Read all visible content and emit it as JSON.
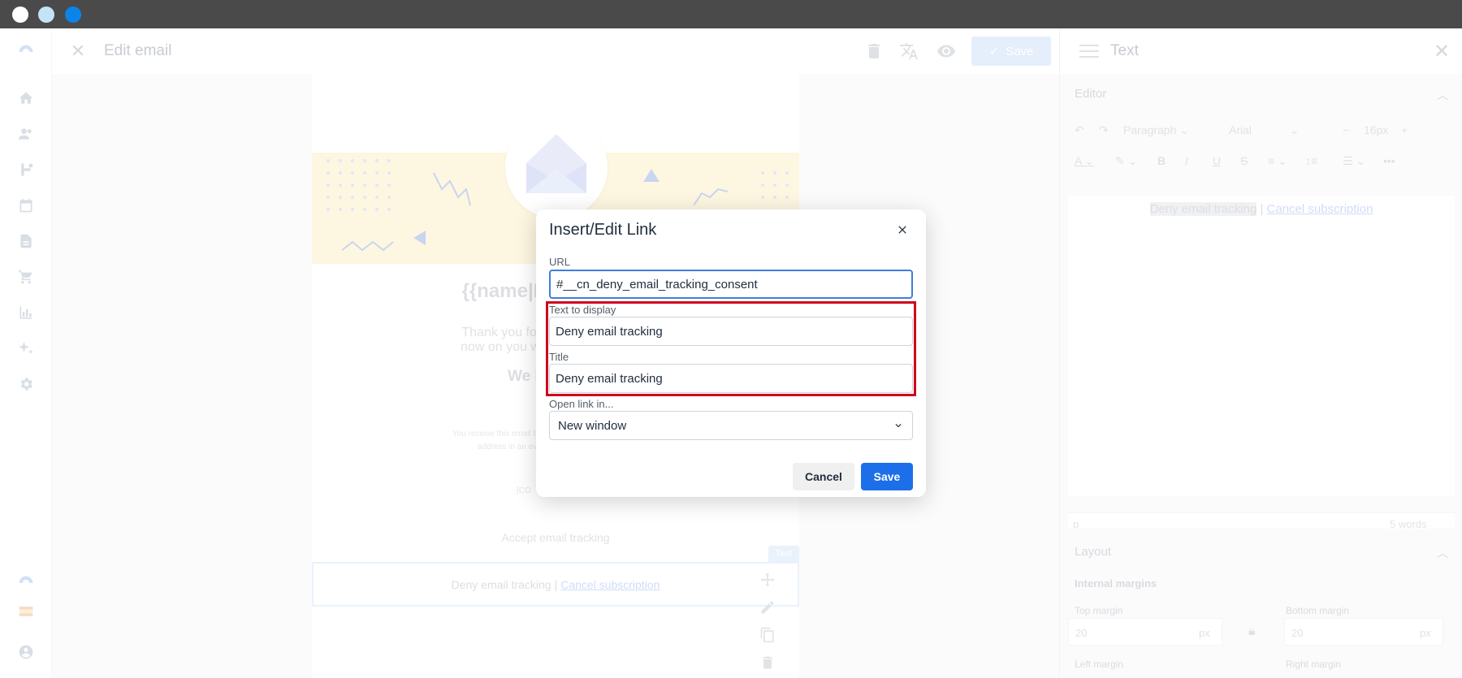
{
  "colors": {
    "accent": "#1c6fe8",
    "highlight_border": "#d0021b",
    "window_bar": "#4a4a4a"
  },
  "window": {
    "controls": [
      "close",
      "minimize",
      "maximize"
    ]
  },
  "sidebar": {
    "items": [
      {
        "icon": "logo-icon"
      },
      {
        "icon": "home-icon"
      },
      {
        "icon": "contacts-icon"
      },
      {
        "icon": "workflow-icon"
      },
      {
        "icon": "calendar-icon"
      },
      {
        "icon": "document-icon"
      },
      {
        "icon": "cart-icon"
      },
      {
        "icon": "chart-icon"
      },
      {
        "icon": "sparkle-icon"
      },
      {
        "icon": "settings-icon"
      }
    ],
    "bottom": [
      {
        "icon": "brand-icon"
      },
      {
        "icon": "spain-flag-icon"
      },
      {
        "icon": "user-icon"
      }
    ]
  },
  "header": {
    "title": "Edit email",
    "save_label": "Save",
    "icons": [
      "trash-icon",
      "translate-icon",
      "eye-icon"
    ]
  },
  "email": {
    "greeting": "{{name|Hello}}, welc",
    "thanks_line1": "Thank you for subscribing, we ar",
    "thanks_line2": "now on you will receive all the ne",
    "hope": "We hope you",
    "fine_line1": "You receive this email because you have subscribed to th",
    "fine_line2": "address in an event held, and we believe th",
    "company": "[CO",
    "accept_tracking": "Accept email tracking",
    "deny_tracking": "Deny email tracking",
    "separator": "|",
    "cancel_subscription": "Cancel subscription",
    "block_tag": "Text"
  },
  "right_panel": {
    "title": "Text",
    "editor_section": "Editor",
    "block_format": "Paragraph",
    "font_family": "Arial",
    "font_size": "16px",
    "editor_text_deny": "Deny email tracking",
    "editor_separator": "|",
    "editor_text_cancel": "Cancel subscription",
    "path": "p",
    "word_count": "5 words",
    "layout_section": "Layout",
    "internal_margins": "Internal margins",
    "top_margin_label": "Top margin",
    "top_margin_value": "20",
    "bottom_margin_label": "Bottom margin",
    "bottom_margin_value": "20",
    "unit": "px",
    "left_margin_label": "Left margin",
    "right_margin_label": "Right margin"
  },
  "dialog": {
    "title": "Insert/Edit Link",
    "url_label": "URL",
    "url_value": "#__cn_deny_email_tracking_consent",
    "text_label": "Text to display",
    "text_value": "Deny email tracking",
    "title_label": "Title",
    "title_value": "Deny email tracking",
    "open_label": "Open link in...",
    "open_value": "New window",
    "cancel": "Cancel",
    "save": "Save"
  }
}
